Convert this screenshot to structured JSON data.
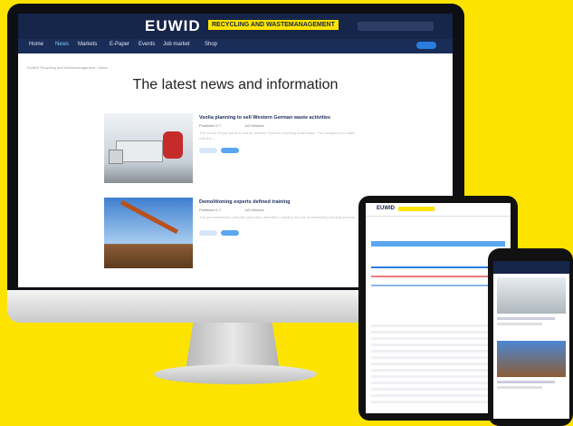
{
  "site": {
    "logo": "EUWID",
    "logo_tag": "RECYCLING AND WASTEMANAGEMENT",
    "nav": [
      "Home",
      "News",
      "Markets",
      "E-Paper",
      "Events",
      "Job market",
      "Shop"
    ],
    "active_nav": "News",
    "page_title": "The latest news and information",
    "breadcrumb": "EUWID Recycling and Wastemanagement › News"
  },
  "articles": [
    {
      "title": "Veolia planning to sell Western German waste activities",
      "meta": "Published 2.7.",
      "reads": "1x5 Minutes",
      "text": "The Veolia Group wants to sell its western German recycling businesses. The company is in talks with the ...",
      "image": "waste-truck"
    },
    {
      "title": "Demolitioning experts defined training",
      "meta": "Published 2.7.",
      "reads": "1x5 Minutes",
      "text": "The pre-established principle grounded demolition industry has the demolitioning training process ...",
      "image": "demolition-excavator"
    }
  ],
  "colors": {
    "brand_navy": "#16254a",
    "brand_yellow": "#fde400",
    "link_blue": "#2a7de0"
  }
}
